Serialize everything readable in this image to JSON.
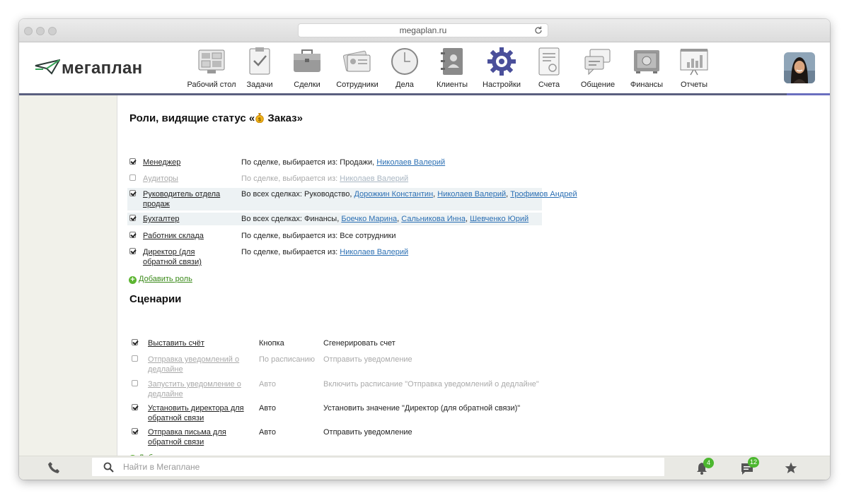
{
  "browser": {
    "url": "megaplan.ru"
  },
  "logo": {
    "text": "мегаплан"
  },
  "nav": [
    {
      "label": "Рабочий стол",
      "icon": "desktop-icon"
    },
    {
      "label": "Задачи",
      "icon": "tasks-clipboard-icon"
    },
    {
      "label": "Сделки",
      "icon": "briefcase-icon"
    },
    {
      "label": "Сотрудники",
      "icon": "id-cards-icon"
    },
    {
      "label": "Дела",
      "icon": "clock-icon"
    },
    {
      "label": "Клиенты",
      "icon": "address-book-icon"
    },
    {
      "label": "Настройки",
      "icon": "gear-icon"
    },
    {
      "label": "Счета",
      "icon": "invoice-icon"
    },
    {
      "label": "Общение",
      "icon": "chat-bubbles-icon"
    },
    {
      "label": "Финансы",
      "icon": "safe-icon"
    },
    {
      "label": "Отчеты",
      "icon": "report-chart-icon"
    }
  ],
  "roles": {
    "title_pre": "Роли, видящие статус «",
    "title_status": "Заказ",
    "title_post": "»",
    "rows": [
      {
        "checked": true,
        "enabled": true,
        "highlight": false,
        "name": "Менеджер",
        "prefix": "По сделке, выбирается из: Продажи, ",
        "links": [
          "Николаев Валерий"
        ]
      },
      {
        "checked": false,
        "enabled": false,
        "highlight": false,
        "name": "Аудиторы",
        "prefix": "По сделке, выбирается из: ",
        "links": [
          "Николаев Валерий"
        ]
      },
      {
        "checked": true,
        "enabled": true,
        "highlight": true,
        "name": "Руководитель отдела продаж",
        "prefix": "Во всех сделках: Руководство, ",
        "links": [
          "Дорожкин Константин",
          "Николаев Валерий",
          "Трофимов Андрей"
        ]
      },
      {
        "checked": true,
        "enabled": true,
        "highlight": true,
        "name": "Бухгалтер",
        "prefix": "Во всех сделках: Финансы, ",
        "links": [
          "Боечко Марина",
          "Сальникова Инна",
          "Шевченко Юрий"
        ]
      },
      {
        "checked": true,
        "enabled": true,
        "highlight": false,
        "name": "Работник склада",
        "prefix": "По сделке, выбирается из: Все сотрудники",
        "links": []
      },
      {
        "checked": true,
        "enabled": true,
        "highlight": false,
        "name": "Директор (для обратной связи)",
        "prefix": "По сделке, выбирается из: ",
        "links": [
          "Николаев Валерий"
        ]
      }
    ],
    "add_label": "Добавить роль"
  },
  "scenarios": {
    "title": "Сценарии",
    "rows": [
      {
        "checked": true,
        "enabled": true,
        "name": "Выставить счёт",
        "trigger": "Кнопка",
        "action": "Сгенерировать счет"
      },
      {
        "checked": false,
        "enabled": false,
        "name": "Отправка уведомлений о дедлайне",
        "trigger": "По расписанию",
        "action": "Отправить уведомление"
      },
      {
        "checked": false,
        "enabled": false,
        "name": "Запустить уведомление о дедлайне",
        "trigger": "Авто",
        "action": "Включить расписание \"Отправка уведомлений о дедлайне\""
      },
      {
        "checked": true,
        "enabled": true,
        "name": "Установить директора для обратной связи",
        "trigger": "Авто",
        "action": "Установить значение \"Директор (для обратной связи)\""
      },
      {
        "checked": true,
        "enabled": true,
        "name": "Отправка письма для обратной связи",
        "trigger": "Авто",
        "action": "Отправить уведомление"
      }
    ],
    "add_label": "Добавление сценария"
  },
  "bottombar": {
    "search_placeholder": "Найти в Мегаплане",
    "notifications_count": "4",
    "messages_count": "12"
  },
  "colors": {
    "accent_line": "#6a6fbf",
    "link": "#2b6fb3",
    "green": "#4cb72f",
    "settings_icon": "#4a4f9a"
  }
}
